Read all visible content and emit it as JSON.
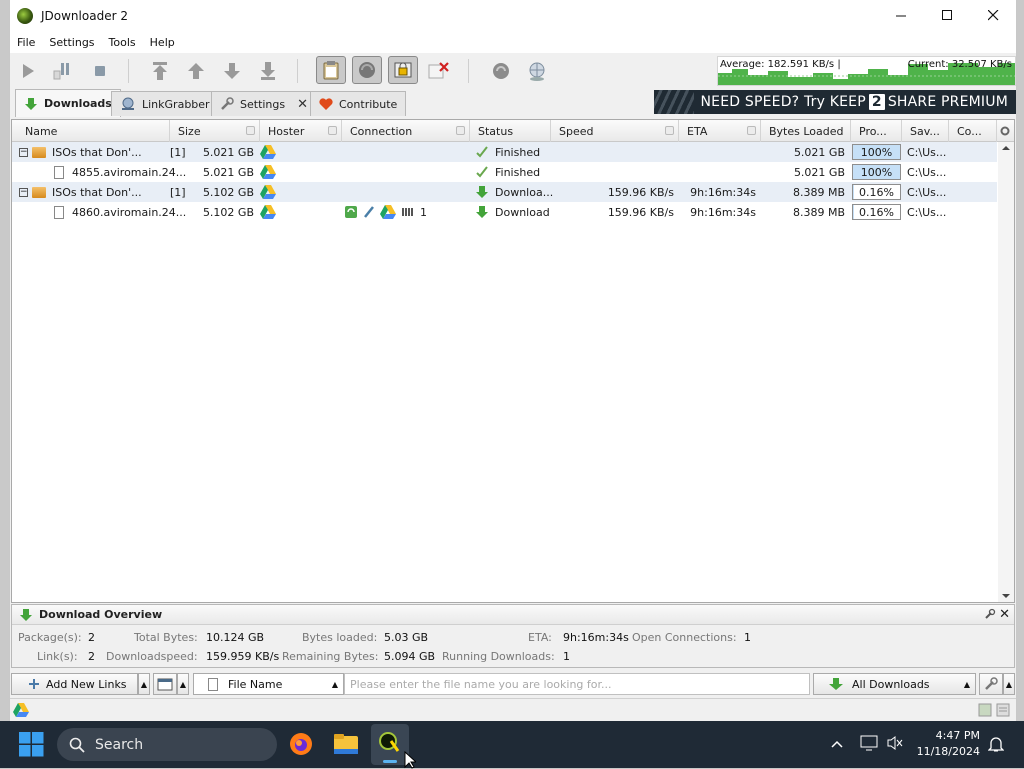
{
  "window": {
    "title": "JDownloader 2"
  },
  "menu": [
    "File",
    "Settings",
    "Tools",
    "Help"
  ],
  "speed": {
    "average": "Average: 182.591 KB/s |",
    "current": "Current: 32.507 KB/s"
  },
  "tabs": [
    {
      "label": "Downloads"
    },
    {
      "label": "LinkGrabber"
    },
    {
      "label": "Settings"
    },
    {
      "label": "Contribute"
    }
  ],
  "banner": {
    "pre": "NEED SPEED? Try KEEP",
    "num": "2",
    "post": "SHARE PREMIUM"
  },
  "columns": [
    "Name",
    "Size",
    "Hoster",
    "Connection",
    "Status",
    "Speed",
    "ETA",
    "Bytes Loaded",
    "Pro...",
    "Sav...",
    "Co..."
  ],
  "rows": [
    {
      "type": "package",
      "expander": "−",
      "name": "ISOs that Don'...",
      "count": "[1]",
      "size": "5.021 GB",
      "connection": "",
      "status": "Finished",
      "speed": "",
      "eta": "",
      "bytes": "5.021 GB",
      "progress": "100%",
      "save": "C:\\Us..."
    },
    {
      "type": "link",
      "name": "4855.aviromain.24...",
      "count": "",
      "size": "5.021 GB",
      "connection": "",
      "status": "Finished",
      "speed": "",
      "eta": "",
      "bytes": "5.021 GB",
      "progress": "100%",
      "save": "C:\\Us..."
    },
    {
      "type": "package",
      "expander": "−",
      "name": "ISOs that Don'...",
      "count": "[1]",
      "size": "5.102 GB",
      "connection": "",
      "status": "Downloa...",
      "speed": "159.96 KB/s",
      "eta": "9h:16m:34s",
      "bytes": "8.389 MB",
      "progress": "0.16%",
      "save": "C:\\Us..."
    },
    {
      "type": "link",
      "name": "4860.aviromain.24...",
      "count": "",
      "size": "5.102 GB",
      "connection": "1",
      "status": "Download",
      "speed": "159.96 KB/s",
      "eta": "9h:16m:34s",
      "bytes": "8.389 MB",
      "progress": "0.16%",
      "save": "C:\\Us..."
    }
  ],
  "overview": {
    "title": "Download Overview",
    "packages_label": "Package(s):",
    "packages": "2",
    "total_bytes_label": "Total Bytes:",
    "total_bytes": "10.124 GB",
    "bytes_loaded_label": "Bytes loaded:",
    "bytes_loaded": "5.03 GB",
    "eta_label": "ETA:",
    "eta": "9h:16m:34s",
    "open_conn_label": "Open Connections:",
    "open_conn": "1",
    "links_label": "Link(s):",
    "links": "2",
    "dlspeed_label": "Downloadspeed:",
    "dlspeed": "159.959 KB/s",
    "remaining_label": "Remaining Bytes:",
    "remaining": "5.094 GB",
    "running_label": "Running Downloads:",
    "running": "1"
  },
  "bottombar": {
    "add_links": "Add New Links",
    "filter_field": "File Name",
    "search_placeholder": "Please enter the file name you are looking for...",
    "view_select": "All Downloads"
  },
  "taskbar": {
    "search": "Search",
    "time": "4:47 PM",
    "date": "11/18/2024"
  },
  "colors": {
    "accent": "#c6e0f7",
    "taskbar": "#1f2a36",
    "graph_fill": "#4fb34a"
  }
}
